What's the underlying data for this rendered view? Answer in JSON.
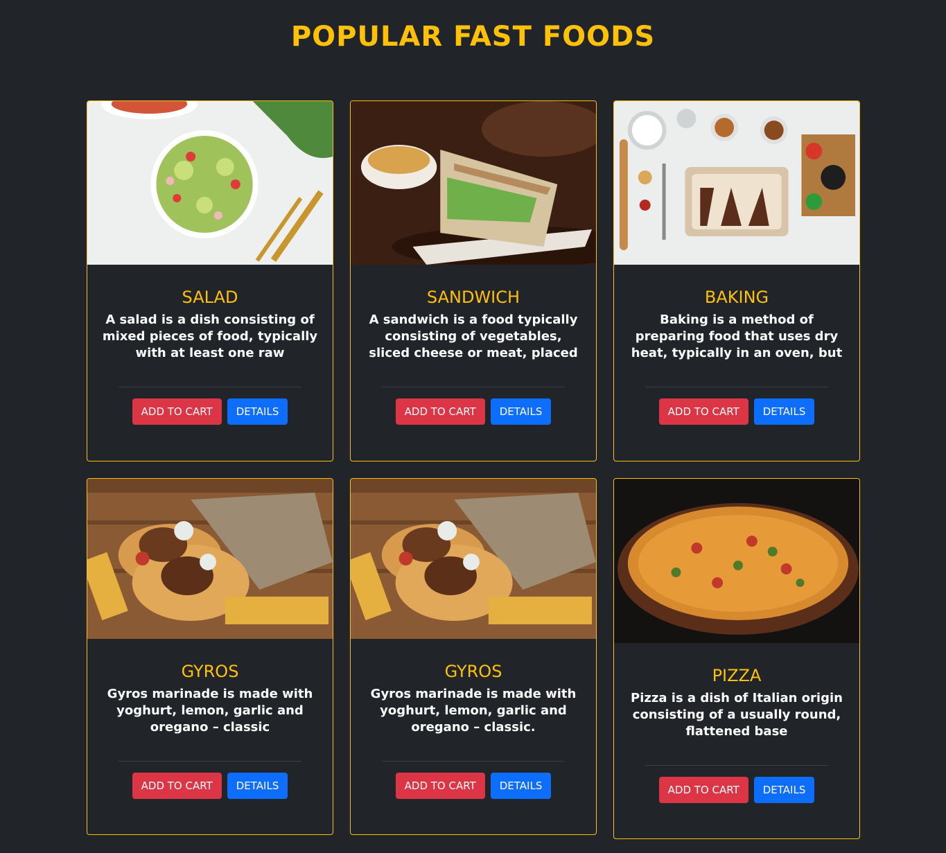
{
  "header": {
    "title": "POPULAR FAST FOODS"
  },
  "colors": {
    "background": "#212529",
    "accent": "#ffc107",
    "cart_button": "#dc3545",
    "details_button": "#0d6efd"
  },
  "cards": [
    {
      "title": "SALAD",
      "text": "A salad is a dish consisting of mixed pieces of food, typically with at least one raw ingredient.",
      "cart_label": "ADD TO CART",
      "details_label": "DETAILS"
    },
    {
      "title": "SANDWICH",
      "text": "A sandwich is a food typically consisting of vegetables, sliced cheese or meat, placed on or",
      "cart_label": "ADD TO CART",
      "details_label": "DETAILS"
    },
    {
      "title": "BAKING",
      "text": "Baking is a method of preparing food that uses dry heat, typically in an oven, but can also be done",
      "cart_label": "ADD TO CART",
      "details_label": "DETAILS"
    },
    {
      "title": "GYROS",
      "text": "Gyros marinade is made with yoghurt, lemon, garlic and oregano – classic",
      "cart_label": "ADD TO CART",
      "details_label": "DETAILS"
    },
    {
      "title": "GYROS",
      "text": "Gyros marinade is made with yoghurt, lemon, garlic and oregano – classic.",
      "cart_label": "ADD TO CART",
      "details_label": "DETAILS"
    },
    {
      "title": "PIZZA",
      "text": "Pizza is a dish of Italian origin consisting of a usually round, flattened base",
      "cart_label": "ADD TO CART",
      "details_label": "DETAILS"
    }
  ]
}
